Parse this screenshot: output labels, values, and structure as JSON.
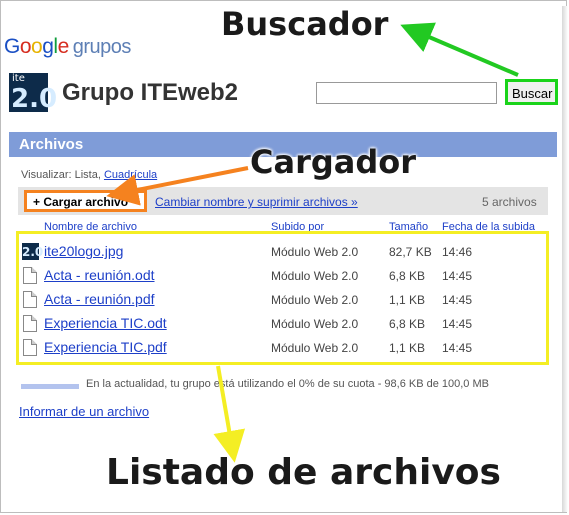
{
  "logo": {
    "google": "Google",
    "grupos": "grupos"
  },
  "group": {
    "icon_small": "ite",
    "icon_big": "2.0",
    "title": "Grupo ITEweb2"
  },
  "search": {
    "value": "",
    "button_label": "Buscar"
  },
  "section": {
    "title": "Archivos"
  },
  "view": {
    "prefix": "Visualizar: Lista,",
    "grid_link": "Cuadrícula"
  },
  "toolbar": {
    "upload_label": "+ Cargar archivo",
    "rename_label": "Cambiar nombre y suprimir archivos »",
    "file_count": "5 archivos"
  },
  "table": {
    "headers": [
      "Nombre de archivo",
      "Subido por",
      "Tamaño",
      "Fecha de la subida"
    ],
    "rows": [
      {
        "name": "ite20logo.jpg",
        "uploader": "Módulo Web 2.0",
        "size": "82,7 KB",
        "date": "14:46",
        "icon": "image-thumbnail-icon"
      },
      {
        "name": "Acta - reunión.odt",
        "uploader": "Módulo Web 2.0",
        "size": "6,8 KB",
        "date": "14:45",
        "icon": "document-icon"
      },
      {
        "name": "Acta - reunión.pdf",
        "uploader": "Módulo Web 2.0",
        "size": "1,1 KB",
        "date": "14:45",
        "icon": "document-icon"
      },
      {
        "name": "Experiencia TIC.odt",
        "uploader": "Módulo Web 2.0",
        "size": "6,8 KB",
        "date": "14:45",
        "icon": "document-icon"
      },
      {
        "name": "Experiencia TIC.pdf",
        "uploader": "Módulo Web 2.0",
        "size": "1,1 KB",
        "date": "14:45",
        "icon": "document-icon"
      }
    ]
  },
  "quota": {
    "text": "En la actualidad, tu grupo está utilizando el 0% de su cuota - 98,6 KB de 100,0 MB",
    "used_percent": 0
  },
  "report_link": "Informar de un archivo",
  "annotations": {
    "buscador": "Buscador",
    "cargador": "Cargador",
    "listado": "Listado de archivos"
  },
  "colors": {
    "search_highlight": "#1ad31a",
    "upload_highlight": "#f5821f",
    "list_highlight": "#f4ee24",
    "section_bar": "#7f9cd8",
    "link": "#1d3fc8"
  }
}
